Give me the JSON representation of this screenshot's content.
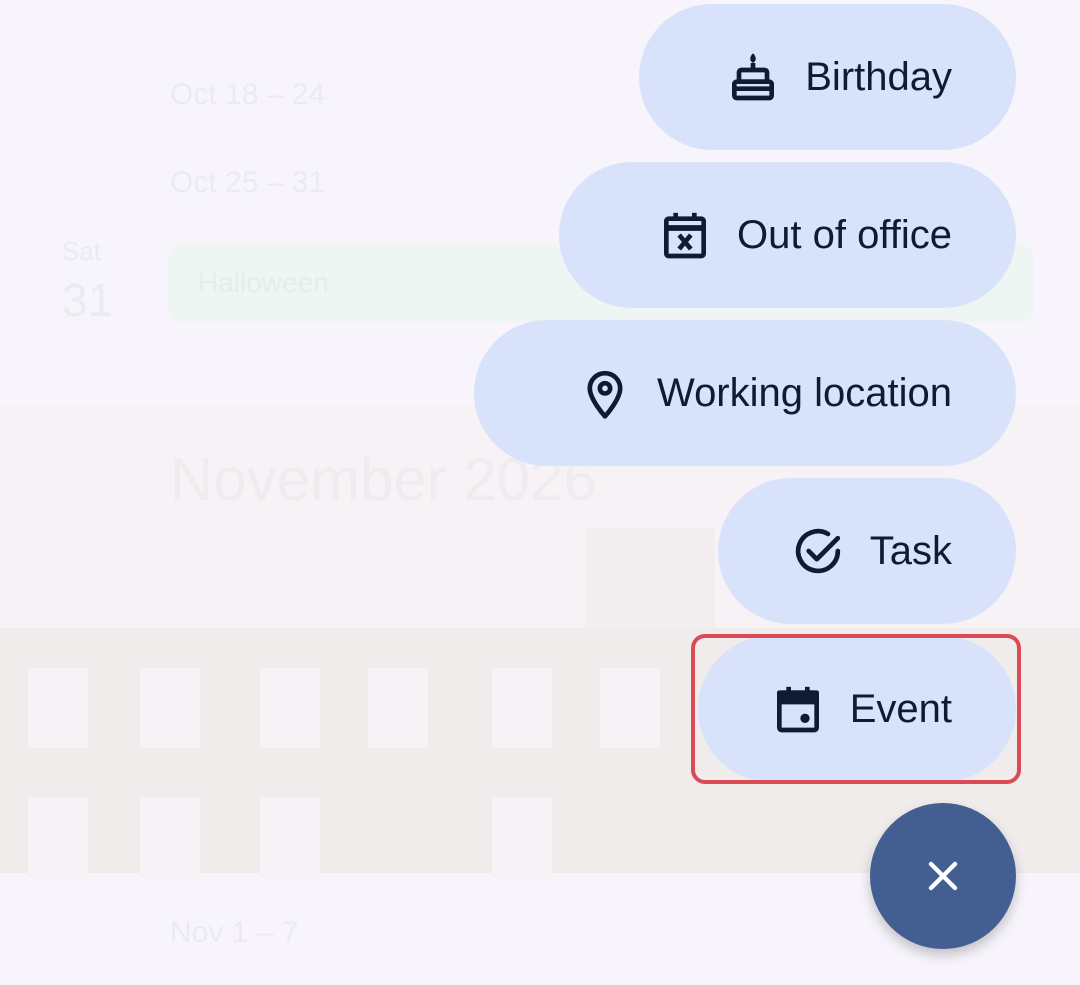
{
  "background": {
    "weeks_top": [
      "Oct 18 – 24",
      "Oct 25 – 31"
    ],
    "day": {
      "dow": "Sat",
      "num": "31"
    },
    "event_chip": "Halloween",
    "month_title": "November 2026",
    "week_bottom": "Nov 1 – 7"
  },
  "speed_dial": {
    "items": [
      {
        "label": "Birthday",
        "icon": "cake-icon"
      },
      {
        "label": "Out of office",
        "icon": "calendar-x-icon"
      },
      {
        "label": "Working location",
        "icon": "location-pin-icon"
      },
      {
        "label": "Task",
        "icon": "task-check-icon"
      },
      {
        "label": "Event",
        "icon": "calendar-event-icon"
      }
    ],
    "fab_icon": "close-icon"
  },
  "colors": {
    "pill_bg": "#d8e3fb",
    "pill_text": "#0d1b33",
    "fab_bg": "#435f92",
    "highlight": "#db4b56"
  }
}
